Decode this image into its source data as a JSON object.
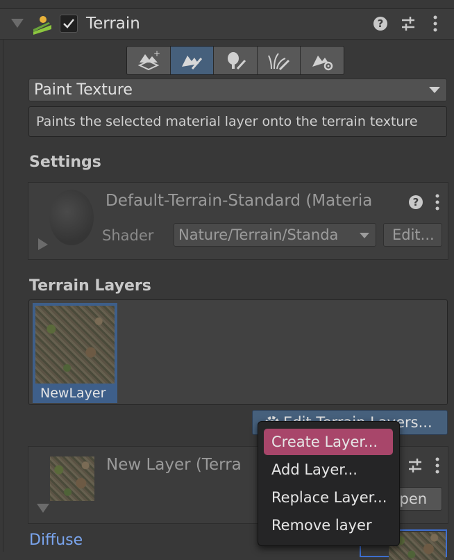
{
  "component": {
    "title": "Terrain",
    "enabled": true
  },
  "tool_mode": {
    "selected": "Paint Texture",
    "description": "Paints the selected material layer onto the terrain texture",
    "tools": [
      "create-neighbor-terrains",
      "paint-terrain",
      "paint-trees",
      "paint-details",
      "terrain-settings"
    ],
    "active_tool_index": 1
  },
  "settings": {
    "heading": "Settings",
    "material_name": "Default-Terrain-Standard (Materia",
    "shader_label": "Shader",
    "shader_value": "Nature/Terrain/Standa",
    "edit_button": "Edit..."
  },
  "terrain_layers": {
    "heading": "Terrain Layers",
    "layers": [
      {
        "name": "NewLayer",
        "selected": true
      }
    ],
    "edit_button": "Edit Terrain Layers..."
  },
  "layer_inspector": {
    "title": "New Layer (Terra",
    "open_button": "Open"
  },
  "diffuse_label": "Diffuse",
  "context_menu": {
    "items": [
      {
        "label": "Create Layer...",
        "highlighted": true
      },
      {
        "label": "Add Layer...",
        "highlighted": false
      },
      {
        "label": "Replace Layer...",
        "highlighted": false
      },
      {
        "label": "Remove layer",
        "highlighted": false
      }
    ]
  },
  "colors": {
    "background": "#383838",
    "active_tool": "#46607c",
    "menu_highlight": "#a8466a",
    "link_blue": "#7aa5ee"
  }
}
